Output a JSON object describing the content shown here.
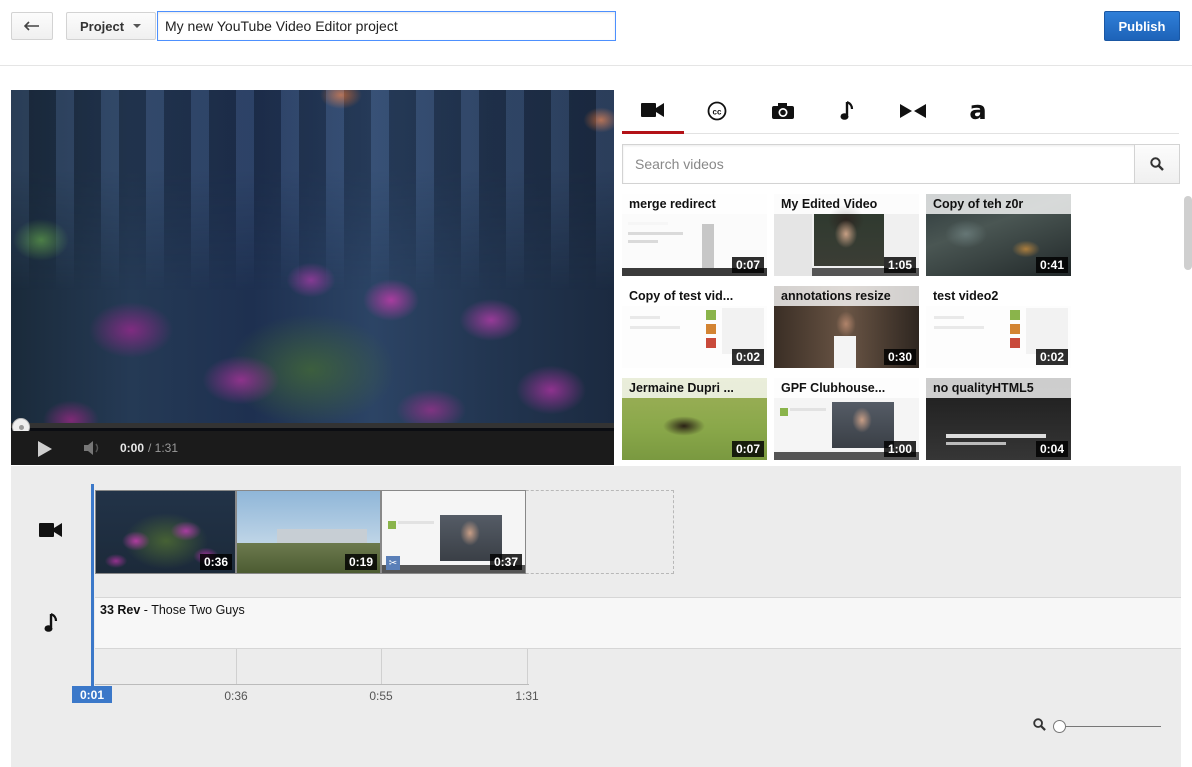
{
  "header": {
    "project_label": "Project",
    "title_value": "My new YouTube Video Editor project",
    "publish_label": "Publish"
  },
  "player": {
    "current_time": "0:00",
    "total_time": "/ 1:31"
  },
  "library": {
    "tabs": [
      {
        "icon": "video-camera-icon",
        "active": true
      },
      {
        "icon": "closed-captions-icon",
        "active": false
      },
      {
        "icon": "camera-icon",
        "active": false
      },
      {
        "icon": "music-note-icon",
        "active": false
      },
      {
        "icon": "transitions-icon",
        "active": false
      },
      {
        "icon": "amazon-a-icon",
        "label": "a",
        "active": false
      }
    ],
    "search_placeholder": "Search videos",
    "videos": [
      {
        "title": "merge redirect",
        "duration": "0:07"
      },
      {
        "title": "My Edited Video",
        "duration": "1:05"
      },
      {
        "title": "Copy of teh z0r",
        "duration": "0:41"
      },
      {
        "title": "Copy of test vid...",
        "duration": "0:02"
      },
      {
        "title": "annotations resize",
        "duration": "0:30"
      },
      {
        "title": "test video2",
        "duration": "0:02"
      },
      {
        "title": "Jermaine Dupri ...",
        "duration": "0:07"
      },
      {
        "title": "GPF Clubhouse...",
        "duration": "1:00"
      },
      {
        "title": "no qualityHTML5",
        "duration": "0:04"
      }
    ]
  },
  "timeline": {
    "clips": [
      {
        "duration": "0:36"
      },
      {
        "duration": "0:19"
      },
      {
        "duration": "0:37"
      }
    ],
    "audio": {
      "song": "33 Rev",
      "artist": " - Those Two Guys"
    },
    "ticks": [
      "0:36",
      "0:55",
      "1:31"
    ],
    "playhead_time": "0:01"
  }
}
